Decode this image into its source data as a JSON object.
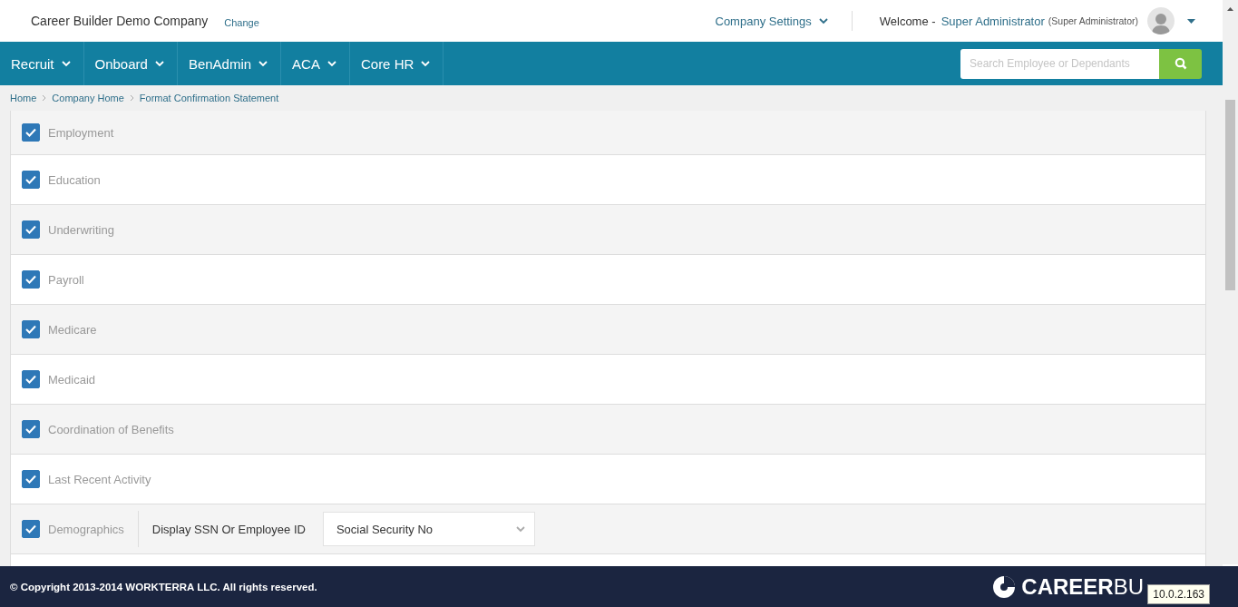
{
  "header": {
    "company": "Career Builder Demo Company",
    "change_link": "Change",
    "settings_menu": "Company Settings",
    "welcome": "Welcome -",
    "user_name": "Super Administrator",
    "user_role": "(Super Administrator)"
  },
  "nav": {
    "items": [
      {
        "label": "Recruit"
      },
      {
        "label": "Onboard"
      },
      {
        "label": "BenAdmin"
      },
      {
        "label": "ACA"
      },
      {
        "label": "Core HR"
      }
    ],
    "search": {
      "placeholder": "Search Employee or Dependants"
    }
  },
  "breadcrumb": [
    "Home",
    "Company Home",
    "Format Confirmation Statement"
  ],
  "sections": [
    {
      "kind": "checkbox",
      "label": "Employment",
      "checked": true
    },
    {
      "kind": "checkbox",
      "label": "Education",
      "checked": true
    },
    {
      "kind": "checkbox",
      "label": "Underwriting",
      "checked": true
    },
    {
      "kind": "checkbox",
      "label": "Payroll",
      "checked": true
    },
    {
      "kind": "checkbox",
      "label": "Medicare",
      "checked": true
    },
    {
      "kind": "checkbox",
      "label": "Medicaid",
      "checked": true
    },
    {
      "kind": "checkbox",
      "label": "Coordination of Benefits",
      "checked": true
    },
    {
      "kind": "checkbox",
      "label": "Last Recent Activity",
      "checked": true
    },
    {
      "kind": "option",
      "label": "Demographics",
      "checked": true,
      "option_label": "Display SSN Or Employee ID",
      "option_value": "Social Security No"
    }
  ],
  "footer": {
    "copyright": "© Copyright 2013-2014 WORKTERRA LLC. All rights reserved.",
    "logo_text": "**CAREER**BU",
    "version_tooltip": "10.0.2.163"
  }
}
